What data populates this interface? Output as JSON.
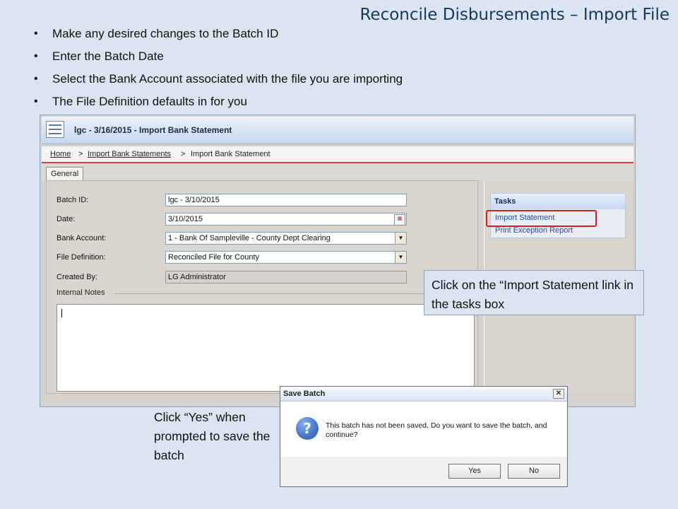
{
  "slide": {
    "title": "Reconcile Disbursements – Import File",
    "bullets": [
      "Make any desired changes to the Batch ID",
      "Enter the Batch Date",
      "Select the Bank Account associated with the file you are importing",
      "The File Definition defaults in for you"
    ]
  },
  "window": {
    "title": "lgc - 3/16/2015 - Import Bank Statement",
    "breadcrumb": [
      "Home",
      "Import Bank Statements",
      "Import Bank Statement"
    ],
    "breadcrumb_sep": ">",
    "tab": "General"
  },
  "form": {
    "batch_id_label": "Batch ID:",
    "batch_id_value": "lgc - 3/10/2015",
    "date_label": "Date:",
    "date_value": "3/10/2015",
    "bank_account_label": "Bank Account:",
    "bank_account_value": "1 - Bank Of Sampleville - County Dept Clearing",
    "file_definition_label": "File Definition:",
    "file_definition_value": "Reconciled File for County",
    "created_by_label": "Created By:",
    "created_by_value": "LG Administrator",
    "internal_notes_label": "Internal Notes",
    "internal_notes_value": ""
  },
  "tasks": {
    "header": "Tasks",
    "items": [
      "Import Statement",
      "Print Exception Report"
    ]
  },
  "callouts": {
    "import": "Click on the “Import Statement link in the tasks box",
    "yes": "Click “Yes” when prompted to save the batch"
  },
  "dialog": {
    "title": "Save Batch",
    "message": "This batch has not been saved. Do you want to save the batch, and continue?",
    "yes_label": "Yes",
    "no_label": "No"
  },
  "colors": {
    "slide_background": "#dbe5f1",
    "title_color": "#17375e",
    "link_color": "#2a46a8",
    "highlight_border": "#d92020"
  }
}
